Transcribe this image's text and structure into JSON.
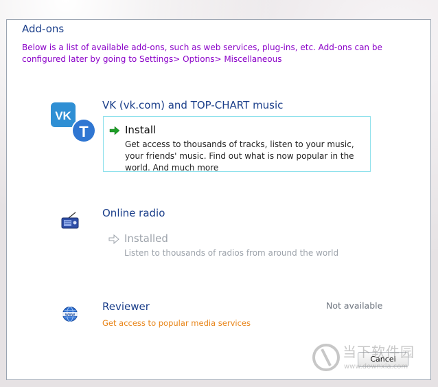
{
  "dialog": {
    "title": "Add-ons",
    "description": "Below is a list of available add-ons, such as web services, plug-ins, etc. Add-ons can be configured later by going to Settings> Options> Miscellaneous"
  },
  "addons": [
    {
      "name": "VK (vk.com) and TOP-CHART music",
      "icon": "vk-icon",
      "action_label": "Install",
      "action_description": "Get access to thousands of tracks, listen to your music, your friends' music. Find out what is now popular in the world. And much more"
    },
    {
      "name": "Online radio",
      "icon": "radio-icon",
      "action_label": "Installed",
      "action_description": "Listen to thousands of radios from around the world"
    },
    {
      "name": "Reviewer",
      "icon": "www-globe-icon",
      "status": "Not available",
      "link_text": "Get access to popular media services"
    }
  ],
  "buttons": {
    "cancel": "Cancel"
  },
  "watermark": {
    "title": "当下软件园",
    "url": "www.downxia.com"
  },
  "colors": {
    "title_blue": "#1a3e8a",
    "description_purple": "#8a00c8",
    "install_green": "#1e9e28",
    "disabled_gray": "#9da3ab",
    "link_orange": "#e88417",
    "box_border": "#8fe1ec"
  }
}
